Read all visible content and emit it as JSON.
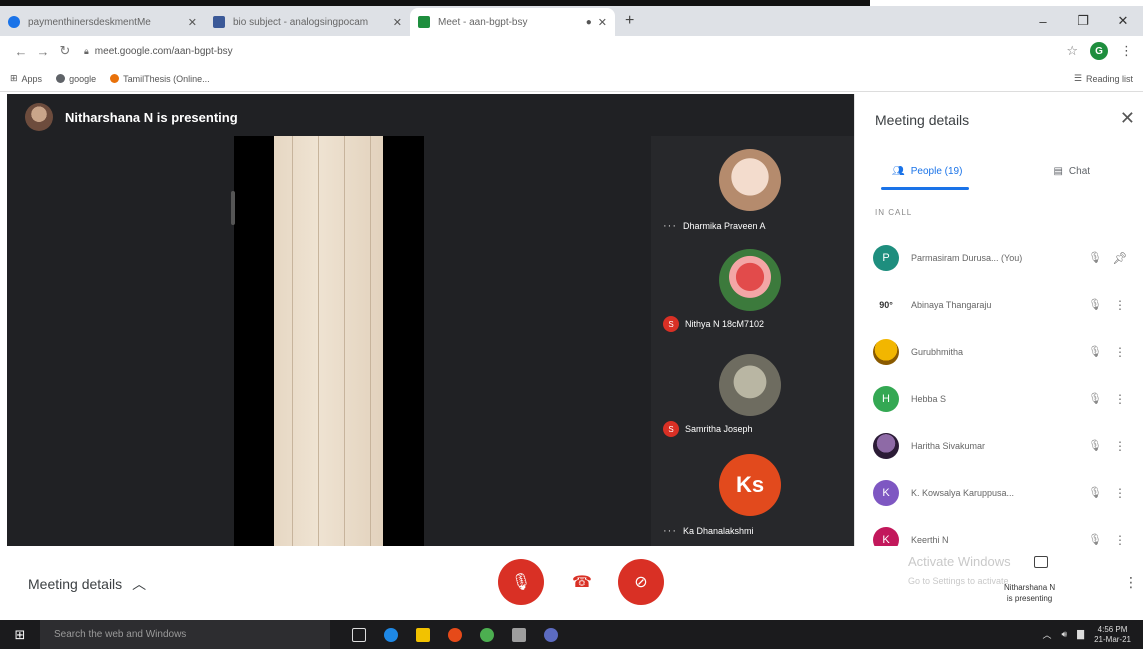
{
  "browser": {
    "tabs": [
      {
        "title": "paymenthinersdeskmentMe",
        "favicon_color": "#1a73e8"
      },
      {
        "title": "bio subject - analogsingpocam",
        "favicon_color": "#3b5998"
      },
      {
        "title": "Meet - aan-bgpt-bsy",
        "favicon_color": "#1e8e3e",
        "active": true
      }
    ],
    "url": "meet.google.com/aan-bgpt-bsy",
    "profile_initial": "G",
    "bookmarks": [
      {
        "label": "Apps",
        "color": "#5f6368"
      },
      {
        "label": "google",
        "color": "#5f6368"
      },
      {
        "label": "TamilThesis (Online...",
        "color": "#e8710a"
      }
    ],
    "reading_list": "Reading list"
  },
  "stage": {
    "presenting_text": "Nitharshana N is presenting",
    "participants": [
      {
        "name": "Dharmika Praveen A",
        "badge": "",
        "face": "#e9d3c3"
      },
      {
        "name": "Nithya N 18cM7102",
        "badge": "S",
        "face": "#c0392b"
      },
      {
        "name": "Samritha Joseph",
        "badge": "S",
        "face": "#8b8a7c"
      },
      {
        "name": "Ka Dhanalakshmi",
        "badge": "",
        "initials": "Ks"
      }
    ]
  },
  "panel": {
    "title": "Meeting details",
    "tabs": {
      "people": "People (19)",
      "chat": "Chat"
    },
    "in_call_label": "IN CALL",
    "people": [
      {
        "initial": "P",
        "name": "Parmasiram Durusa... (You)",
        "color": "#1e8e7e",
        "action": "pin"
      },
      {
        "initial": "90°",
        "name": "Abinaya Thangaraju",
        "color": "#ffffff",
        "text_color": "#333",
        "action": "more"
      },
      {
        "initial": "",
        "name": "Gurubhmitha",
        "color": "#f2b600",
        "action": "more"
      },
      {
        "initial": "H",
        "name": "Hebba S",
        "color": "#34a853",
        "action": "more"
      },
      {
        "initial": "",
        "name": "Haritha Sivakumar",
        "color": "#4a2b5c",
        "action": "more"
      },
      {
        "initial": "K",
        "name": "K. Kowsalya Karuppusa...",
        "color": "#7e57c2",
        "action": "more"
      },
      {
        "initial": "K",
        "name": "Keerthi N",
        "color": "#c2185b",
        "action": "more"
      }
    ]
  },
  "bottom": {
    "meeting_details": "Meeting details",
    "activate_windows": "Activate Windows",
    "activate_sub": "Go to Settings to activate",
    "presenting_line1": "Nitharshana N",
    "presenting_line2": "is presenting"
  },
  "taskbar": {
    "search_placeholder": "Search the web and Windows",
    "time": "4:56 PM",
    "date": "21-Mar-21"
  },
  "colors": {
    "accent": "#1a73e8",
    "danger": "#d93025",
    "stage_bg": "#202124"
  }
}
